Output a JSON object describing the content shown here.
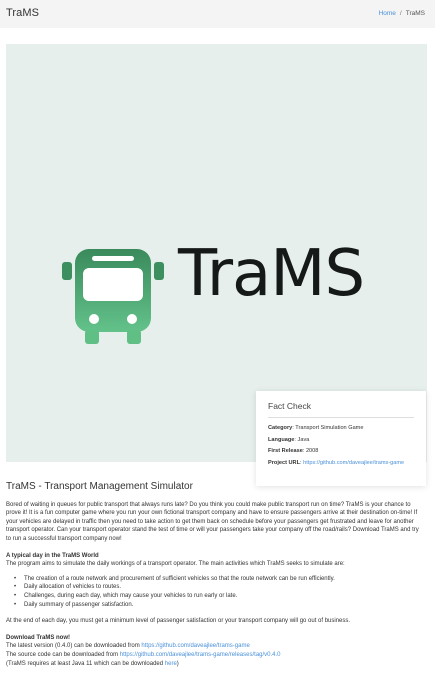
{
  "header": {
    "site_title": "TraMS",
    "breadcrumb_home": "Home",
    "breadcrumb_separator": "/",
    "breadcrumb_current": "TraMS"
  },
  "hero": {
    "logo_text": "TraMS",
    "logo_icon": "bus-icon",
    "background_color": "#e7efed",
    "logo_gradient_top": "#3a8a5c",
    "logo_gradient_bottom": "#5fbf85"
  },
  "fact_check": {
    "title": "Fact Check",
    "category_label": "Category",
    "category_value": "Transport Simulation Game",
    "language_label": "Language",
    "language_value": "Java",
    "first_release_label": "First Release",
    "first_release_value": "2008",
    "project_url_label": "Project URL",
    "project_url_value": "https://github.com/daveajlee/trams-game"
  },
  "main": {
    "title": "TraMS - Transport Management Simulator",
    "intro": "Bored of waiting in queues for public transport that always runs late? Do you think you could make public transport run on time? TraMS is your chance to prove it! It is a fun computer game where you run your own fictional transport company and have to ensure passengers arrive at their destination on-time! If your vehicles are delayed in traffic then you need to take action to get them back on schedule before your passengers get frustrated and leave for another transport operator. Can your transport operator stand the test of time or will your passengers take your company off the road/rails? Download TraMS and try to run a successful transport company now!",
    "typical_day_heading": "A typical day in the TraMS World",
    "typical_day_text": "The program aims to simulate the daily workings of a transport operator. The main activities which TraMS seeks to simulate are:",
    "activities": [
      "The creation of a route network and procurement of sufficient vehicles so that the route network can be run efficiently.",
      "Daily allocation of vehicles to routes.",
      "Challenges, during each day, which may cause your vehicles to run early or late.",
      "Daily summary of passenger satisfaction."
    ],
    "end_of_day_text": "At the end of each day, you must get a minimum level of passenger satisfaction or your transport company will go out of business.",
    "download_heading": "Download TraMS now!",
    "download_line1_prefix": "The latest version (0.4.0) can be downloaded from ",
    "download_line1_link": "https://github.com/daveajlee/trams-game",
    "download_line2_prefix": "The source code can be downloaded from ",
    "download_line2_link": "https://github.com/daveajlee/trams-game/releases/tag/v0.4.0",
    "java_note_prefix": "(TraMS requires at least Java 11 which can be downloaded ",
    "java_note_link": "here",
    "java_note_suffix": ")"
  }
}
